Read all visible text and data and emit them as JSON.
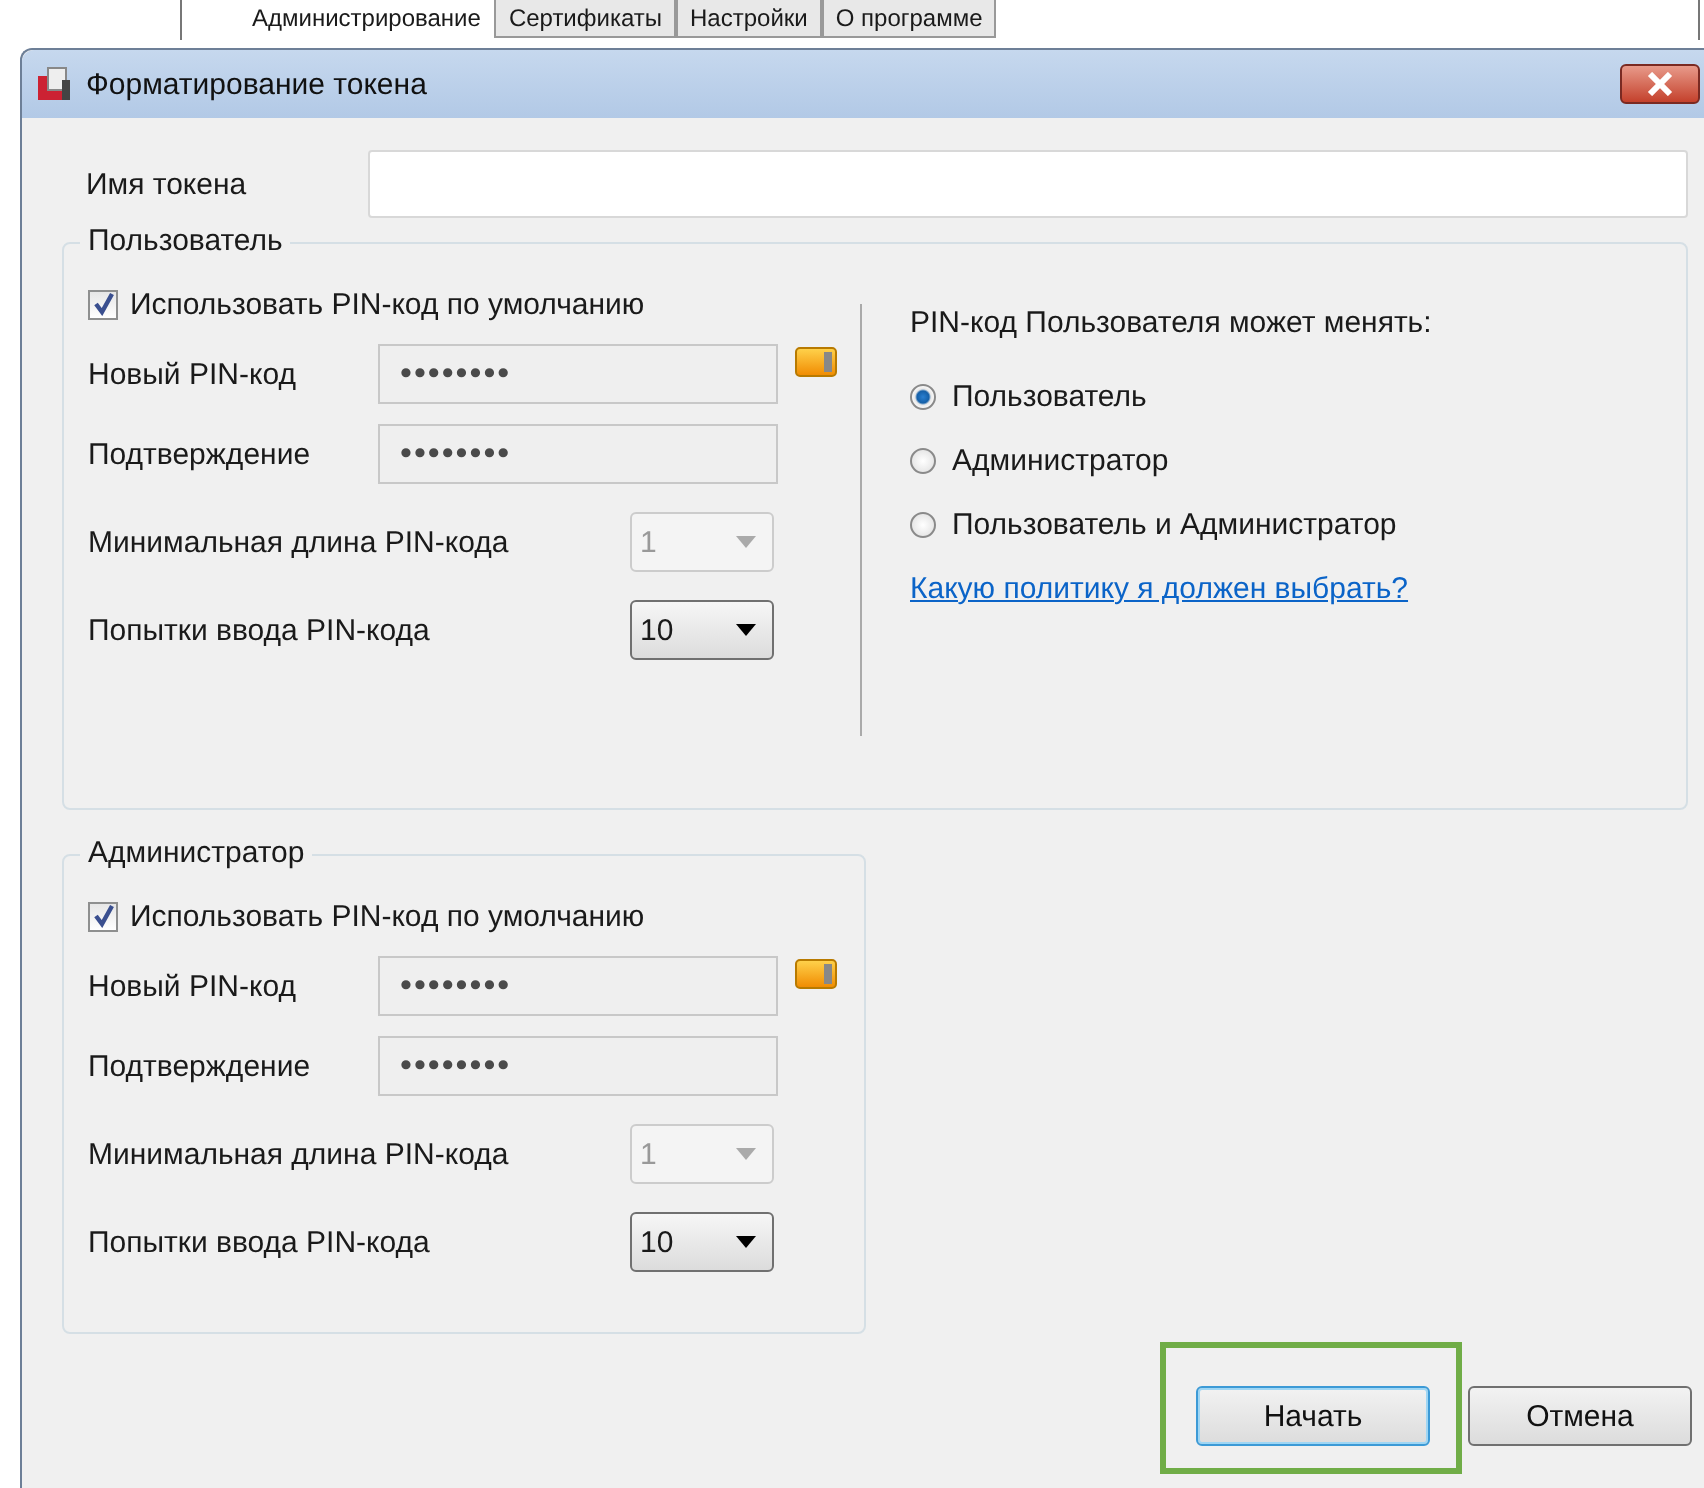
{
  "background_tabs": [
    {
      "label": "Администрирование",
      "selected": true
    },
    {
      "label": "Сертификаты",
      "selected": false
    },
    {
      "label": "Настройки",
      "selected": false
    },
    {
      "label": "О программе",
      "selected": false
    }
  ],
  "window": {
    "title": "Форматирование токена"
  },
  "token_name": {
    "label": "Имя токена"
  },
  "groups": [
    {
      "title": "Пользователь",
      "use_default_pin": {
        "label": "Использовать PIN-код по умолчанию",
        "checked": true
      },
      "new_pin": {
        "label": "Новый PIN-код",
        "value": "••••••••"
      },
      "confirm_pin": {
        "label": "Подтверждение",
        "value": "••••••••"
      },
      "min_length": {
        "label": "Минимальная длина PIN-кода",
        "value": "1",
        "disabled": true
      },
      "attempts": {
        "label": "Попытки ввода PIN-кода",
        "value": "10",
        "disabled": false
      },
      "policy": {
        "title": "PIN-код Пользователя может менять:",
        "options": [
          {
            "label": "Пользователь",
            "selected": true
          },
          {
            "label": "Администратор",
            "selected": false
          },
          {
            "label": "Пользователь и Администратор",
            "selected": false
          }
        ],
        "link": "Какую политику я должен выбрать?"
      }
    },
    {
      "title": "Администратор",
      "use_default_pin": {
        "label": "Использовать PIN-код по умолчанию",
        "checked": true
      },
      "new_pin": {
        "label": "Новый PIN-код",
        "value": "••••••••"
      },
      "confirm_pin": {
        "label": "Подтверждение",
        "value": "••••••••"
      },
      "min_length": {
        "label": "Минимальная длина PIN-кода",
        "value": "1",
        "disabled": true
      },
      "attempts": {
        "label": "Попытки ввода PIN-кода",
        "value": "10",
        "disabled": false
      }
    }
  ],
  "buttons": [
    {
      "label": "Начать",
      "kind": "default",
      "highlighted": true
    },
    {
      "label": "Отмена",
      "kind": "normal",
      "highlighted": false
    }
  ]
}
